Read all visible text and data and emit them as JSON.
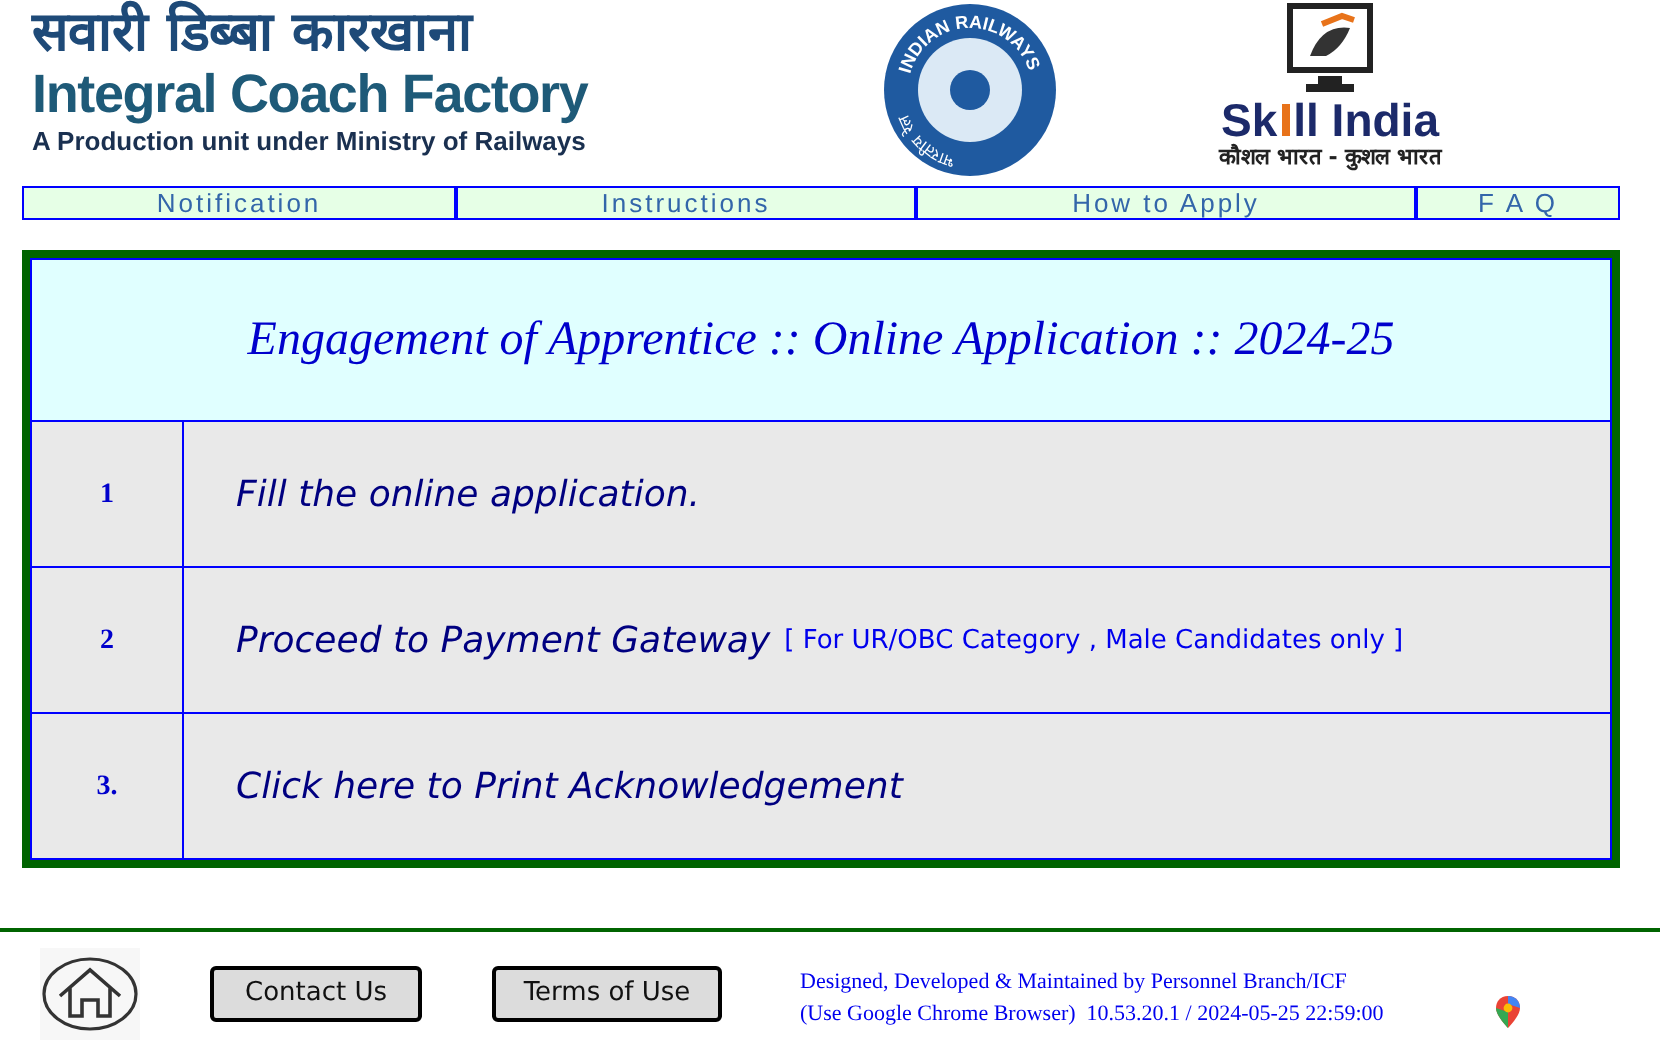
{
  "header": {
    "hindi_title": "सवारी डिब्बा कारखाना",
    "title": "Integral Coach Factory",
    "subtitle": "A Production unit under Ministry of Railways",
    "emblem_text": "INDIAN RAILWAYS",
    "emblem_hindi": "भारतीय रेल",
    "skill_title_start": "Sk",
    "skill_title_end": "ll India",
    "skill_tagline": "कौशल भारत - कुशल भारत"
  },
  "nav": [
    {
      "label": "Notification"
    },
    {
      "label": "Instructions"
    },
    {
      "label": "How to Apply"
    },
    {
      "label": "F A Q"
    }
  ],
  "panel": {
    "title": "Engagement of Apprentice :: Online Application :: 2024-25",
    "rows": [
      {
        "number": "1",
        "text": "Fill the online application."
      },
      {
        "number": "2",
        "text": "Proceed to Payment Gateway",
        "note": "[ For UR/OBC Category , Male Candidates only ]"
      },
      {
        "number": "3.",
        "text": "Click here to Print Acknowledgement"
      }
    ]
  },
  "footer": {
    "buttons": [
      "Contact Us",
      "Terms of Use"
    ],
    "credit": "Designed, Developed & Maintained by Personnel Branch/ICF",
    "browser_note": "(Use Google Chrome Browser)  10.53.20.1 / 2024-05-25 22:59:00"
  }
}
